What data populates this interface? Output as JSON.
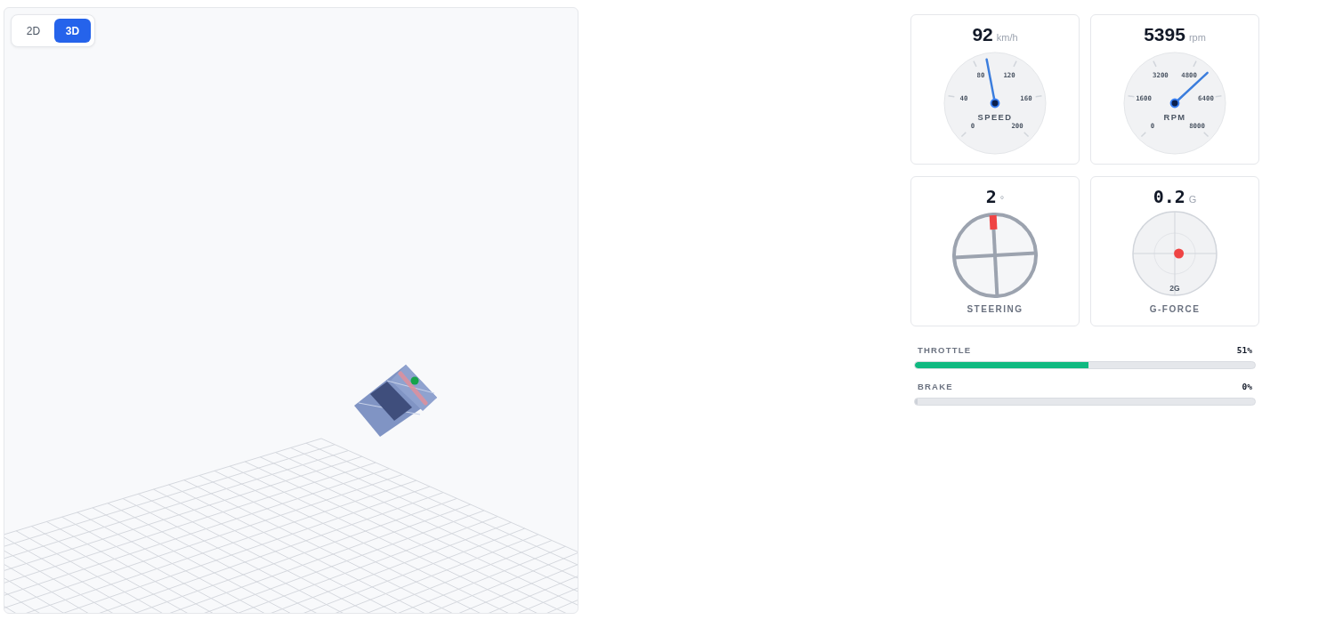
{
  "view_toggle": [
    {
      "label": "2D",
      "selected": false
    },
    {
      "label": "3D",
      "selected": true
    }
  ],
  "gauges": [
    {
      "kind": "dial",
      "value": "92",
      "unit": "km/h",
      "label": "SPEED",
      "ticks": [
        "0",
        "40",
        "80",
        "120",
        "160",
        "200"
      ],
      "level": 0.46
    },
    {
      "kind": "dial",
      "value": "5395",
      "unit": "rpm",
      "label": "RPM",
      "ticks": [
        "0",
        "1600",
        "3200",
        "4800",
        "6400",
        "8000"
      ],
      "level": 0.674
    },
    {
      "kind": "wheel",
      "value": "2",
      "unit": "°",
      "label": "STEERING"
    },
    {
      "kind": "gforce",
      "value": "0.2",
      "unit": "G",
      "label": "G-FORCE",
      "ring_label": "2G",
      "level": 0.55
    }
  ],
  "bars": [
    {
      "label": "THROTTLE",
      "value": "51%",
      "level": 0.51,
      "color": "#10b981"
    },
    {
      "label": "BRAKE",
      "value": "0%",
      "level": 0
    }
  ]
}
